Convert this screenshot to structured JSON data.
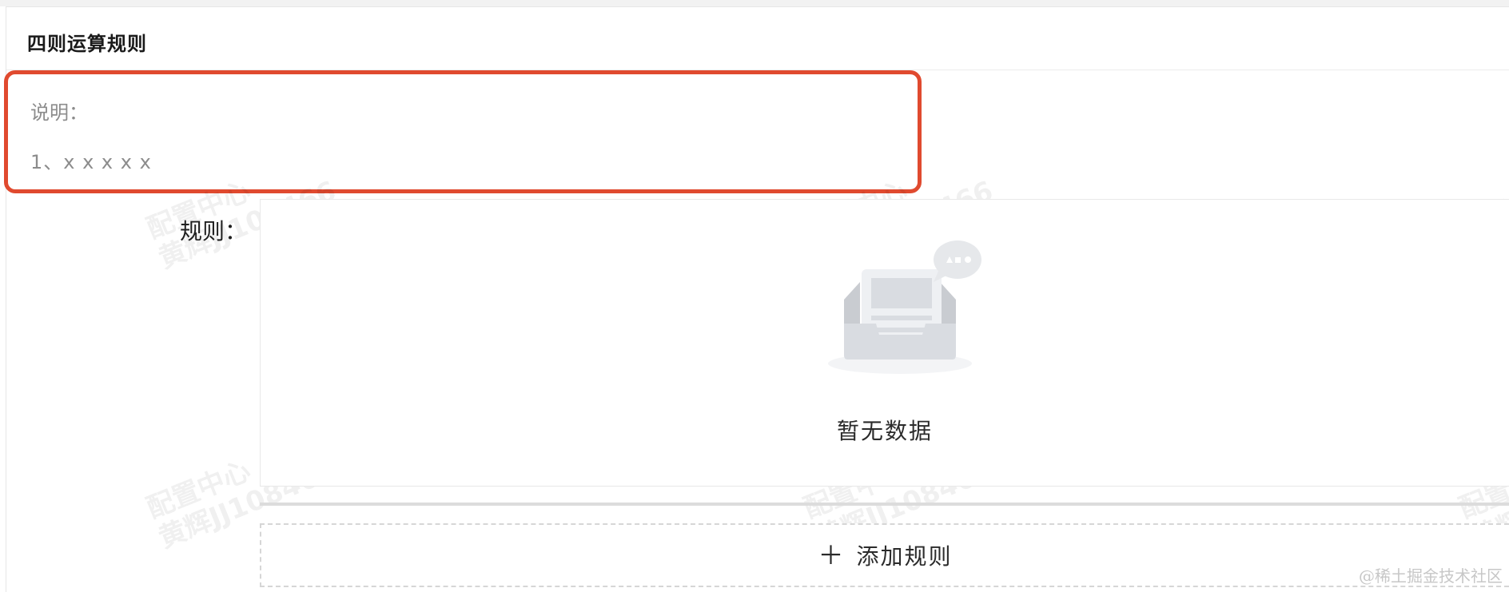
{
  "card": {
    "title": "四则运算规则"
  },
  "description": {
    "label": "说明：",
    "items": [
      "1、x x x x x"
    ]
  },
  "rules": {
    "label": "规则：",
    "empty_text": "暂无数据",
    "add_button": {
      "icon": "plus-icon",
      "label": "添加规则"
    }
  },
  "watermark": {
    "line1": "配置中心",
    "line2": "黄辉JJ108466"
  },
  "site_mark": "@稀土掘金技术社区",
  "colors": {
    "highlight_border": "#e04a2f",
    "muted_text": "#8c8c8c"
  }
}
